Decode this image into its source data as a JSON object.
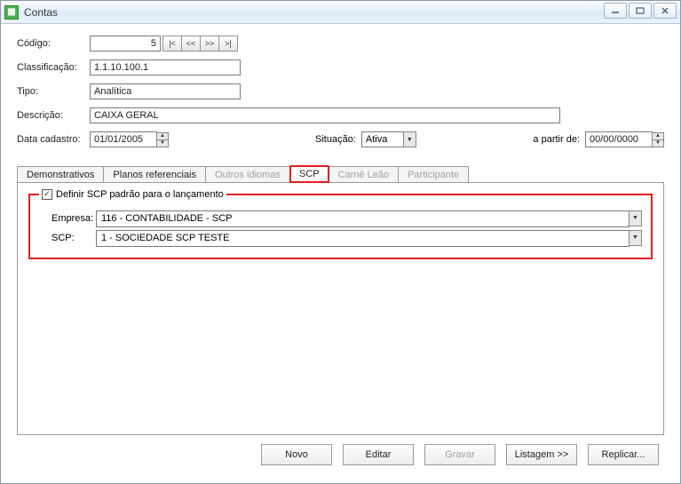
{
  "window": {
    "title": "Contas"
  },
  "form": {
    "codigo_label": "Código:",
    "codigo_value": "5",
    "nav_first": "|<",
    "nav_prev": "<<",
    "nav_next": ">>",
    "nav_last": ">|",
    "classificacao_label": "Classificação:",
    "classificacao_value": "1.1.10.100.1",
    "tipo_label": "Tipo:",
    "tipo_value": "Analítica",
    "descricao_label": "Descrição:",
    "descricao_value": "CAIXA GERAL",
    "datacad_label": "Data cadastro:",
    "datacad_value": "01/01/2005",
    "situacao_label": "Situação:",
    "situacao_value": "Ativa",
    "apartir_label": "a partir de:",
    "apartir_value": "00/00/0000"
  },
  "tabs": {
    "demonstrativos": "Demonstrativos",
    "planos": "Planos referenciais",
    "outros": "Outros idiomas",
    "scp": "SCP",
    "carne": "Carnê Leão",
    "participante": "Participante"
  },
  "scp_panel": {
    "checkbox_label": "Definir SCP padrão para o lançamento",
    "empresa_label": "Empresa:",
    "empresa_value": "116 - CONTABILIDADE - SCP",
    "scp_label": "SCP:",
    "scp_value": "1 - SOCIEDADE SCP TESTE"
  },
  "footer": {
    "novo": "Novo",
    "editar": "Editar",
    "gravar": "Gravar",
    "listagem": "Listagem >>",
    "replicar": "Replicar..."
  }
}
